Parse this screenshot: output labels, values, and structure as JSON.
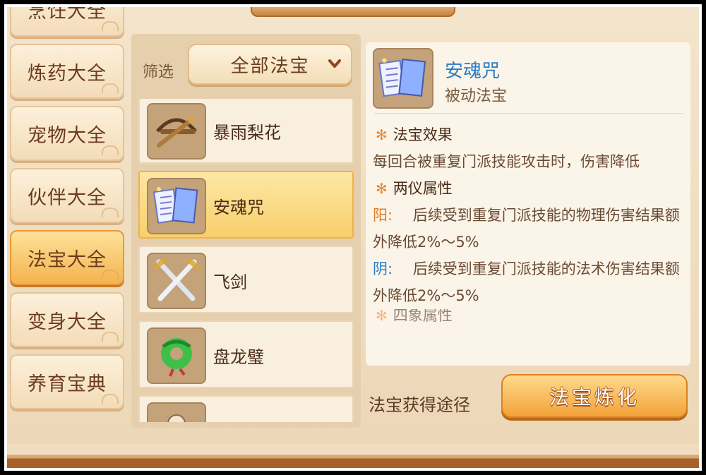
{
  "categories": [
    {
      "label": "烹饪大全",
      "active": false
    },
    {
      "label": "炼药大全",
      "active": false
    },
    {
      "label": "宠物大全",
      "active": false
    },
    {
      "label": "伙伴大全",
      "active": false
    },
    {
      "label": "法宝大全",
      "active": true
    },
    {
      "label": "变身大全",
      "active": false
    },
    {
      "label": "养育宝典",
      "active": false
    }
  ],
  "filter": {
    "label": "筛选",
    "selected": "全部法宝",
    "chevron_icon": "chevron-down-icon"
  },
  "items": [
    {
      "name": "暴雨梨花",
      "icon": "crossbow-icon",
      "selected": false
    },
    {
      "name": "安魂咒",
      "icon": "scroll-book-icon",
      "selected": true
    },
    {
      "name": "飞剑",
      "icon": "crossed-swords-icon",
      "selected": false
    },
    {
      "name": "盘龙璧",
      "icon": "jade-dragon-icon",
      "selected": false
    },
    {
      "name": "",
      "icon": "figure-icon",
      "selected": false
    }
  ],
  "detail": {
    "title": "安魂咒",
    "subtitle": "被动法宝",
    "sections": {
      "effect_title": "法宝效果",
      "effect_text": "每回合被重复门派技能攻击时，伤害降低",
      "two_title": "两仪属性",
      "yang_label": "阳:",
      "yang_text": "后续受到重复门派技能的物理伤害结果额外降低2%～5%",
      "yin_label": "阴:",
      "yin_text": "后续受到重复门派技能的法术伤害结果额外降低2%～5%",
      "four_title": "四象属性"
    }
  },
  "footer": {
    "source_label": "法宝获得途径",
    "refine_button": "法宝炼化"
  }
}
